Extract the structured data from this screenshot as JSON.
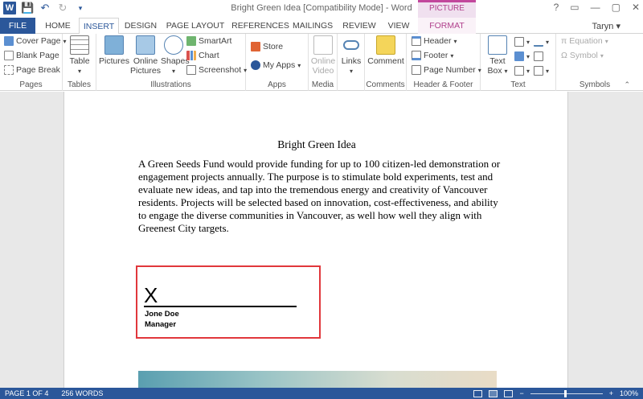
{
  "window": {
    "title": "Bright Green Idea [Compatibility Mode] - Word",
    "contextual_tab_group": "PICTURE TOOLS",
    "controls": [
      "?",
      "▭",
      "—",
      "▢",
      "✕"
    ]
  },
  "tabs": {
    "file": "FILE",
    "items": [
      "HOME",
      "INSERT",
      "DESIGN",
      "PAGE LAYOUT",
      "REFERENCES",
      "MAILINGS",
      "REVIEW",
      "VIEW",
      "FORMAT"
    ],
    "active": "INSERT",
    "user": "Taryn"
  },
  "ribbon": {
    "pages": {
      "label": "Pages",
      "cover_page": "Cover Page",
      "blank_page": "Blank Page",
      "page_break": "Page Break"
    },
    "tables": {
      "label": "Tables",
      "table": "Table"
    },
    "illustrations": {
      "label": "Illustrations",
      "pictures": "Pictures",
      "online_pictures": "Online Pictures",
      "shapes": "Shapes",
      "smartart": "SmartArt",
      "chart": "Chart",
      "screenshot": "Screenshot"
    },
    "apps": {
      "label": "Apps",
      "store": "Store",
      "my_apps": "My Apps"
    },
    "media": {
      "label": "Media",
      "online_video": "Online Video"
    },
    "links": {
      "label": "",
      "links": "Links"
    },
    "comments": {
      "label": "Comments",
      "comment": "Comment"
    },
    "header_footer": {
      "label": "Header & Footer",
      "header": "Header",
      "footer": "Footer",
      "page_number": "Page Number"
    },
    "text": {
      "label": "Text",
      "text_box": "Text Box"
    },
    "symbols": {
      "label": "Symbols",
      "equation": "Equation",
      "symbol": "Symbol"
    }
  },
  "document": {
    "title": "Bright Green Idea",
    "paragraph": "A Green Seeds Fund would provide funding for up to 100 citizen-led demonstration or engagement projects annually. The purpose is to stimulate bold experiments, test and evaluate new ideas, and tap into the tremendous energy and creativity of Vancouver residents. Projects will be selected based on innovation, cost-effectiveness, and ability to engage the diverse communities in Vancouver, as well how well they align with Greenest City targets.",
    "signature": {
      "mark": "X",
      "name": "Jone Doe",
      "role": "Manager"
    }
  },
  "status": {
    "page": "PAGE 1 OF 4",
    "words": "256 WORDS",
    "zoom": "100%",
    "zoom_minus": "−",
    "zoom_plus": "+"
  },
  "colors": {
    "word_blue": "#2b579a",
    "picture_tools": "#c2479c",
    "selection_border": "#e1373c"
  }
}
